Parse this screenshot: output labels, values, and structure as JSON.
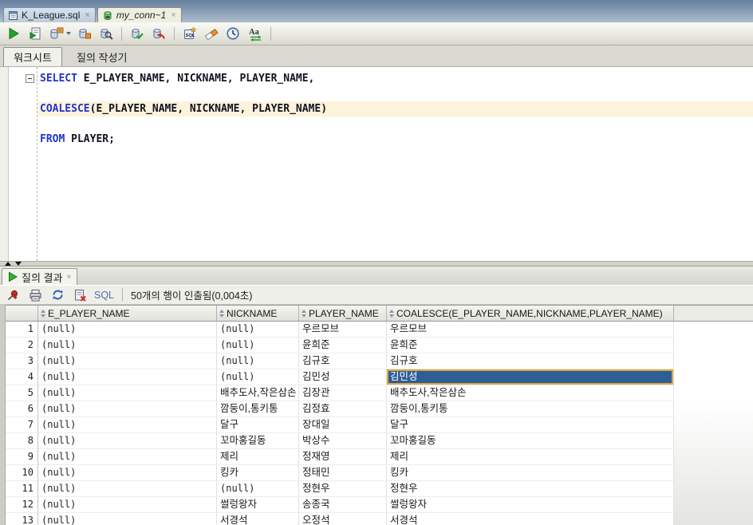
{
  "editor_tabs": [
    {
      "label": "K_League.sql"
    },
    {
      "label": "my_conn~1"
    }
  ],
  "main_toolbar": {
    "buttons": [
      "run-statement",
      "run-script",
      "autotrace",
      "explain-plan",
      "find-db-object",
      "commit",
      "rollback",
      "unshared-worksheet",
      "clear",
      "sql-history",
      "change-case"
    ],
    "change_case_label": "Aa"
  },
  "worksheet_tabs": [
    {
      "label": "워크시트"
    },
    {
      "label": "질의 작성기"
    }
  ],
  "editor": {
    "lines": [
      {
        "fold": true,
        "segments": [
          {
            "text": "SELECT",
            "type": "keyword"
          },
          {
            "text": " E_PLAYER_NAME, NICKNAME, PLAYER_NAME,",
            "type": "plain"
          }
        ]
      },
      {
        "segments": []
      },
      {
        "current": true,
        "segments": [
          {
            "text": "COALESCE",
            "type": "keyword"
          },
          {
            "text": "(E_PLAYER_NAME, NICKNAME, PLAYER_NAME)",
            "type": "plain"
          }
        ]
      },
      {
        "segments": []
      },
      {
        "segments": [
          {
            "text": "FROM",
            "type": "keyword"
          },
          {
            "text": " PLAYER;",
            "type": "plain"
          }
        ]
      }
    ]
  },
  "results": {
    "tab_label": "질의 결과",
    "toolbar_icons": [
      "pin",
      "print",
      "refresh",
      "delete-results"
    ],
    "sql_label": "SQL",
    "status": "50개의 행이 인출됨(0,004초)",
    "grid": {
      "columns": [
        "E_PLAYER_NAME",
        "NICKNAME",
        "PLAYER_NAME",
        "COALESCE(E_PLAYER_NAME,NICKNAME,PLAYER_NAME)"
      ],
      "rows": [
        [
          "1",
          "(null)",
          "(null)",
          "우르모브",
          "우르모브"
        ],
        [
          "2",
          "(null)",
          "(null)",
          "윤희준",
          "윤희준"
        ],
        [
          "3",
          "(null)",
          "(null)",
          "김규호",
          "김규호"
        ],
        [
          "4",
          "(null)",
          "(null)",
          "김민성",
          "김민성"
        ],
        [
          "5",
          "(null)",
          "배추도사,작은삼손",
          "김장관",
          "배추도사,작은삼손"
        ],
        [
          "6",
          "(null)",
          "깜둥이,통키통",
          "김정효",
          "깜둥이,통키통"
        ],
        [
          "7",
          "(null)",
          "달구",
          "장대일",
          "달구"
        ],
        [
          "8",
          "(null)",
          "꼬마홍길동",
          "박상수",
          "꼬마홍길동"
        ],
        [
          "9",
          "(null)",
          "제리",
          "정재영",
          "제리"
        ],
        [
          "10",
          "(null)",
          "킹카",
          "정태민",
          "킹카"
        ],
        [
          "11",
          "(null)",
          "(null)",
          "정현우",
          "정현우"
        ],
        [
          "12",
          "(null)",
          "썰렁왕자",
          "송종국",
          "썰렁왕자"
        ],
        [
          "13",
          "(null)",
          "서경석",
          "오정석",
          "서경석"
        ]
      ],
      "selected_cell": {
        "row": 4,
        "column": 4
      }
    }
  },
  "colors": {
    "selection_bg": "#2D5E96",
    "selection_border": "#DFA53C",
    "line_highlight": "#FCF3DA",
    "keyword_blue": "#2233CC",
    "active_tab_bg": "#EFEFE1"
  }
}
